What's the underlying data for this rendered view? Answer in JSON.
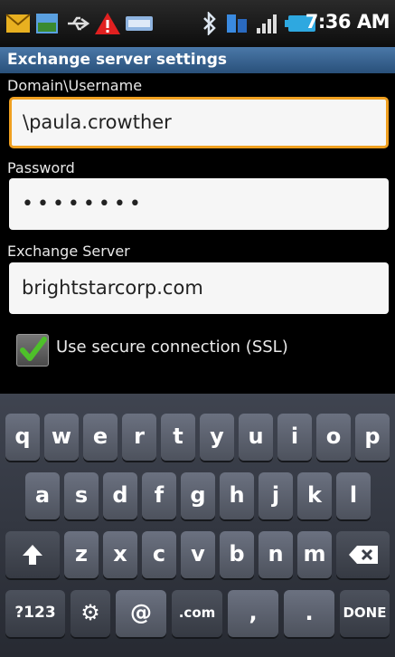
{
  "status_bar": {
    "time": "7:36 AM",
    "icons": [
      "mail-icon",
      "gallery-icon",
      "usb-icon",
      "warning-icon",
      "keyboard-icon",
      "bluetooth-icon",
      "data-icon",
      "signal-icon",
      "battery-icon"
    ]
  },
  "title": "Exchange server settings",
  "form": {
    "domain_label": "Domain\\Username",
    "domain_value": "\\paula.crowther",
    "password_label": "Password",
    "password_value": "••••••••",
    "server_label": "Exchange Server",
    "server_value": "brightstarcorp.com",
    "ssl_label": "Use secure connection (SSL)",
    "ssl_checked": true
  },
  "keyboard": {
    "row1": [
      "q",
      "w",
      "e",
      "r",
      "t",
      "y",
      "u",
      "i",
      "o",
      "p"
    ],
    "row2": [
      "a",
      "s",
      "d",
      "f",
      "g",
      "h",
      "j",
      "k",
      "l"
    ],
    "row3": [
      "z",
      "x",
      "c",
      "v",
      "b",
      "n",
      "m"
    ],
    "mode_key": "?123",
    "at_key": "@",
    "com_key": ".com",
    "comma_key": ",",
    "period_key": ".",
    "done_key": "DONE"
  },
  "colors": {
    "title_bar": "#3a6590",
    "focus_border": "#f0a020",
    "check": "#4ec02a",
    "warning": "#e02020"
  }
}
